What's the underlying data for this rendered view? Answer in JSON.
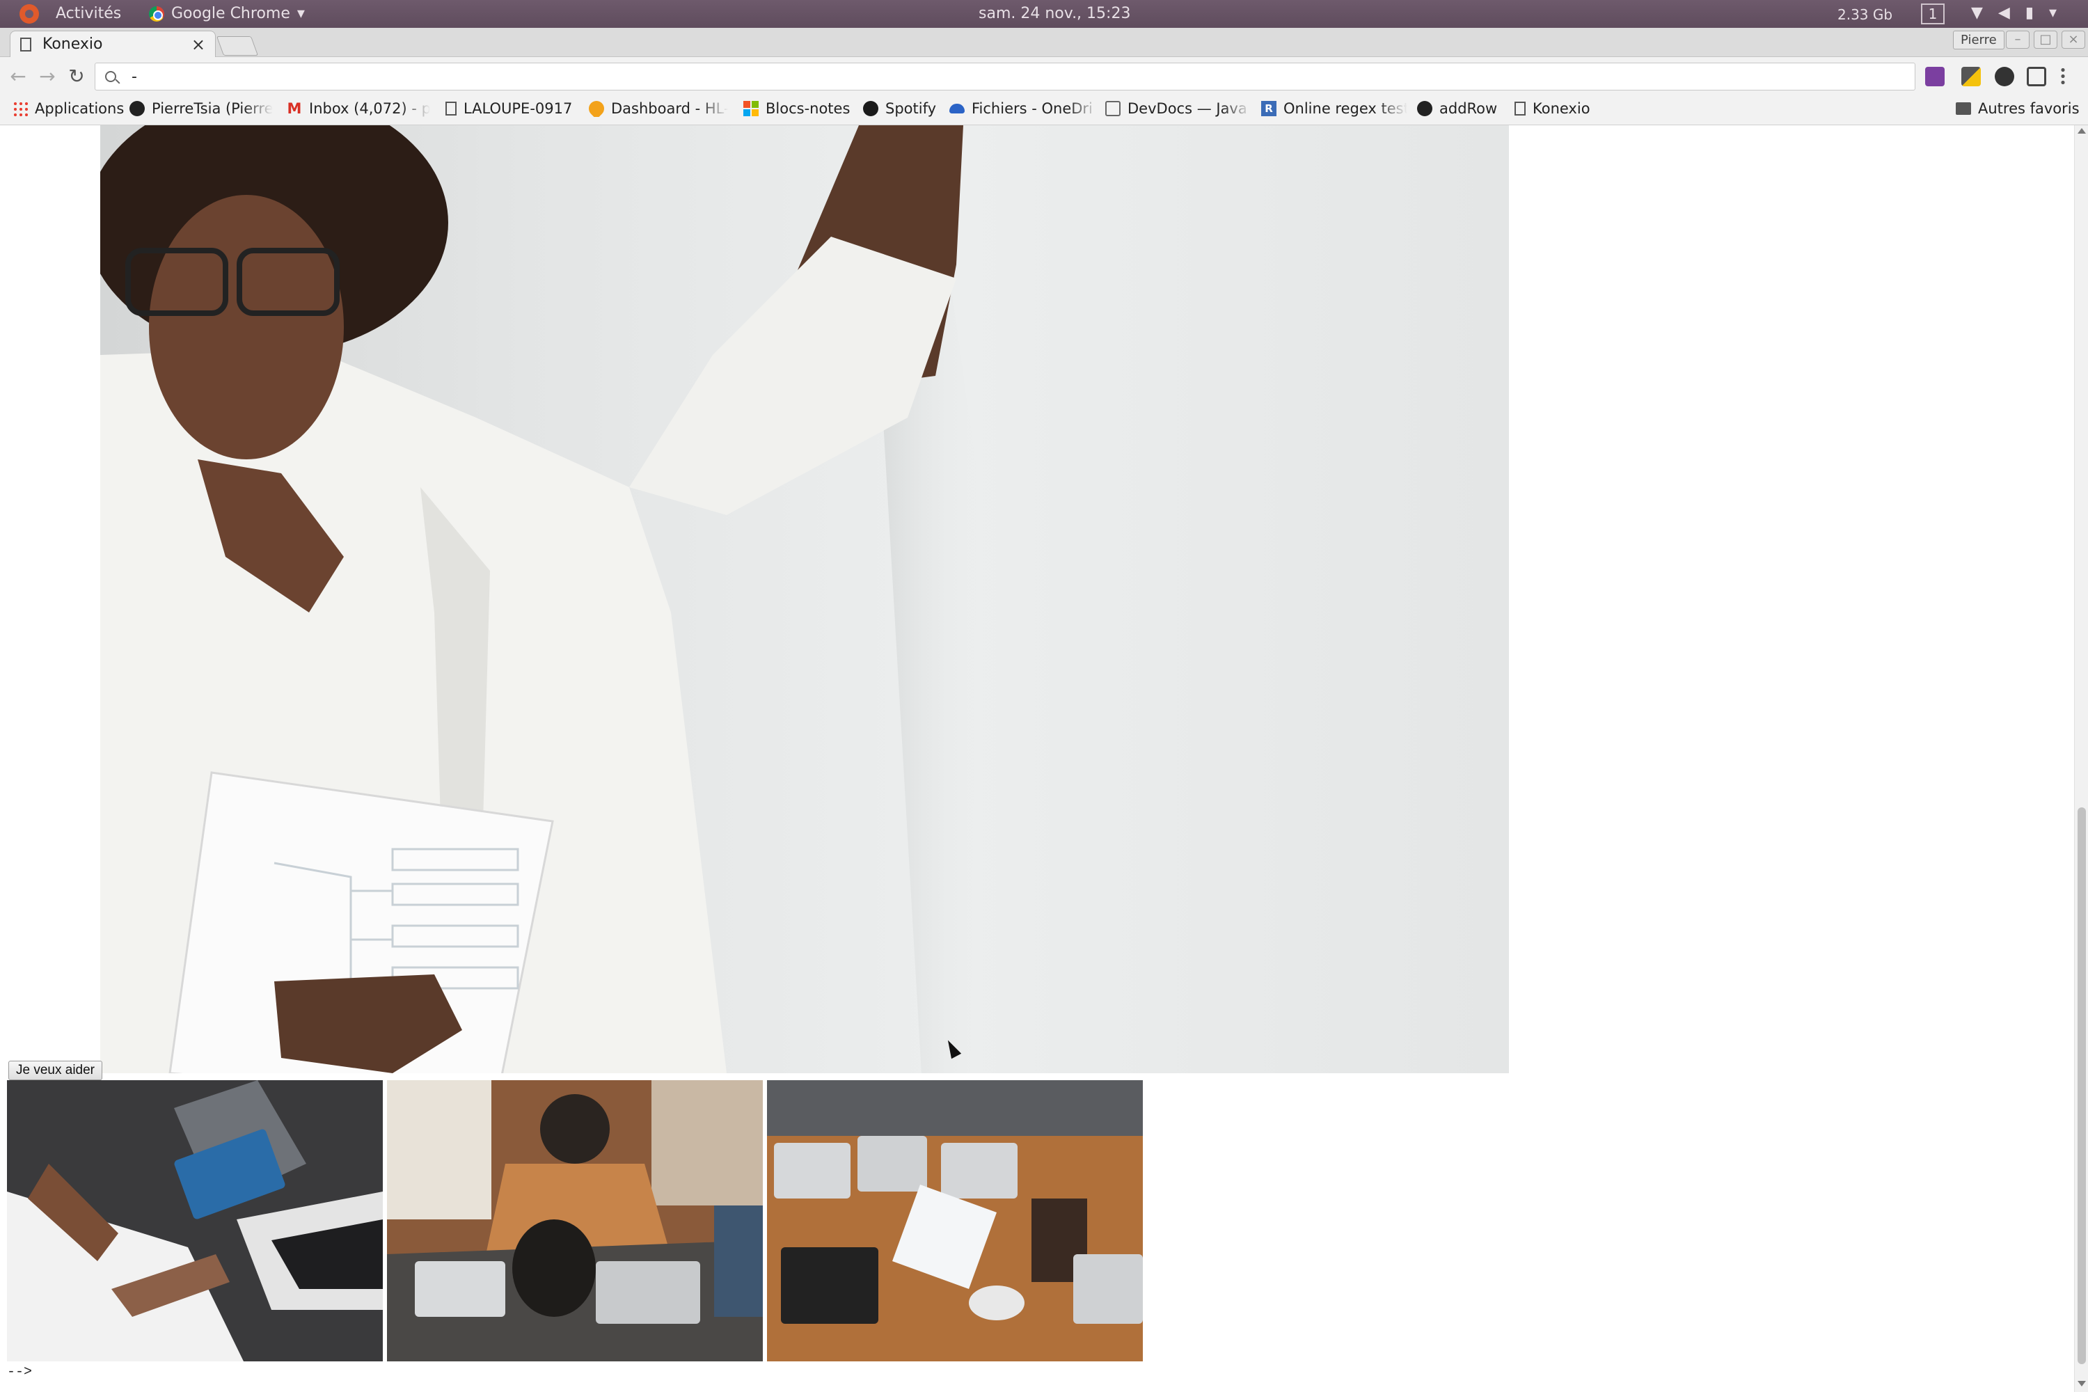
{
  "system_bar": {
    "activities": "Activités",
    "app_name": "Google Chrome",
    "clock": "sam. 24 nov., 15:23",
    "network": "2.33 Gb",
    "workspace": "1"
  },
  "browser": {
    "tab_title": "Konexio",
    "tab_close": "×",
    "profile": "Pierre",
    "omnibox_value": "-",
    "bookmarks": [
      {
        "label": "Applications",
        "icon": "apps-grid-icon"
      },
      {
        "label": "PierreTsia (Pierre",
        "icon": "github-icon"
      },
      {
        "label": "Inbox (4,072) - p",
        "icon": "gmail-icon"
      },
      {
        "label": "LALOUPE-0917",
        "icon": "page-icon"
      },
      {
        "label": "Dashboard - HL-",
        "icon": "dashboard-icon"
      },
      {
        "label": "Blocs-notes",
        "icon": "microsoft-icon"
      },
      {
        "label": "Spotify",
        "icon": "spotify-icon"
      },
      {
        "label": "Fichiers - OneDri",
        "icon": "onedrive-icon"
      },
      {
        "label": "DevDocs — Java",
        "icon": "devdocs-icon"
      },
      {
        "label": "Online regex test",
        "icon": "regex-icon"
      },
      {
        "label": "addRow",
        "icon": "github-icon"
      },
      {
        "label": "Konexio",
        "icon": "page-icon"
      }
    ],
    "other_bookmarks": "Autres favoris"
  },
  "page": {
    "help_button": "Je veux aider",
    "trailing_text": "-->"
  },
  "colors": {
    "topbar": "#5f4c5d",
    "chrome_frame": "#dcdcdc",
    "page_bg": "#ffffff"
  }
}
